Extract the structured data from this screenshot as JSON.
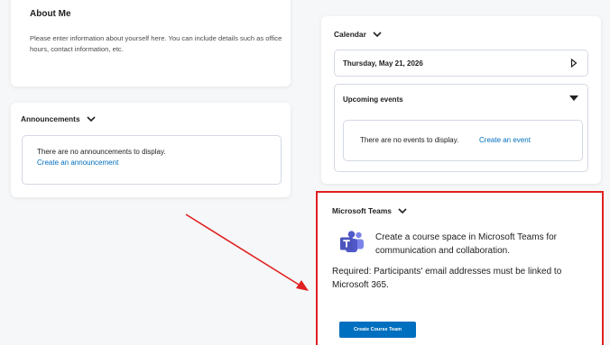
{
  "about_me": {
    "title": "About Me",
    "body": "Please enter information about yourself here. You can include details such as office hours, contact information, etc."
  },
  "announcements": {
    "title": "Announcements",
    "empty_message": "There are no announcements to display.",
    "create_link": "Create an announcement"
  },
  "calendar": {
    "title": "Calendar",
    "date": "Thursday, May 21, 2026",
    "upcoming_label": "Upcoming events",
    "empty_message": "There are no events to display.",
    "create_link": "Create an event"
  },
  "teams": {
    "title": "Microsoft Teams",
    "description": "Create a course space in Microsoft Teams for communication and collaboration.",
    "requirement": "Required: Participants' email addresses must be linked to Microsoft 365.",
    "button_label": "Create Course Team"
  },
  "colors": {
    "link": "#006fbf",
    "highlight_border": "#e02020",
    "button": "#006fbf"
  },
  "icons": [
    "chevron-down-icon",
    "chevron-right-icon",
    "caret-down-icon",
    "microsoft-teams-logo",
    "annotation-arrow"
  ]
}
